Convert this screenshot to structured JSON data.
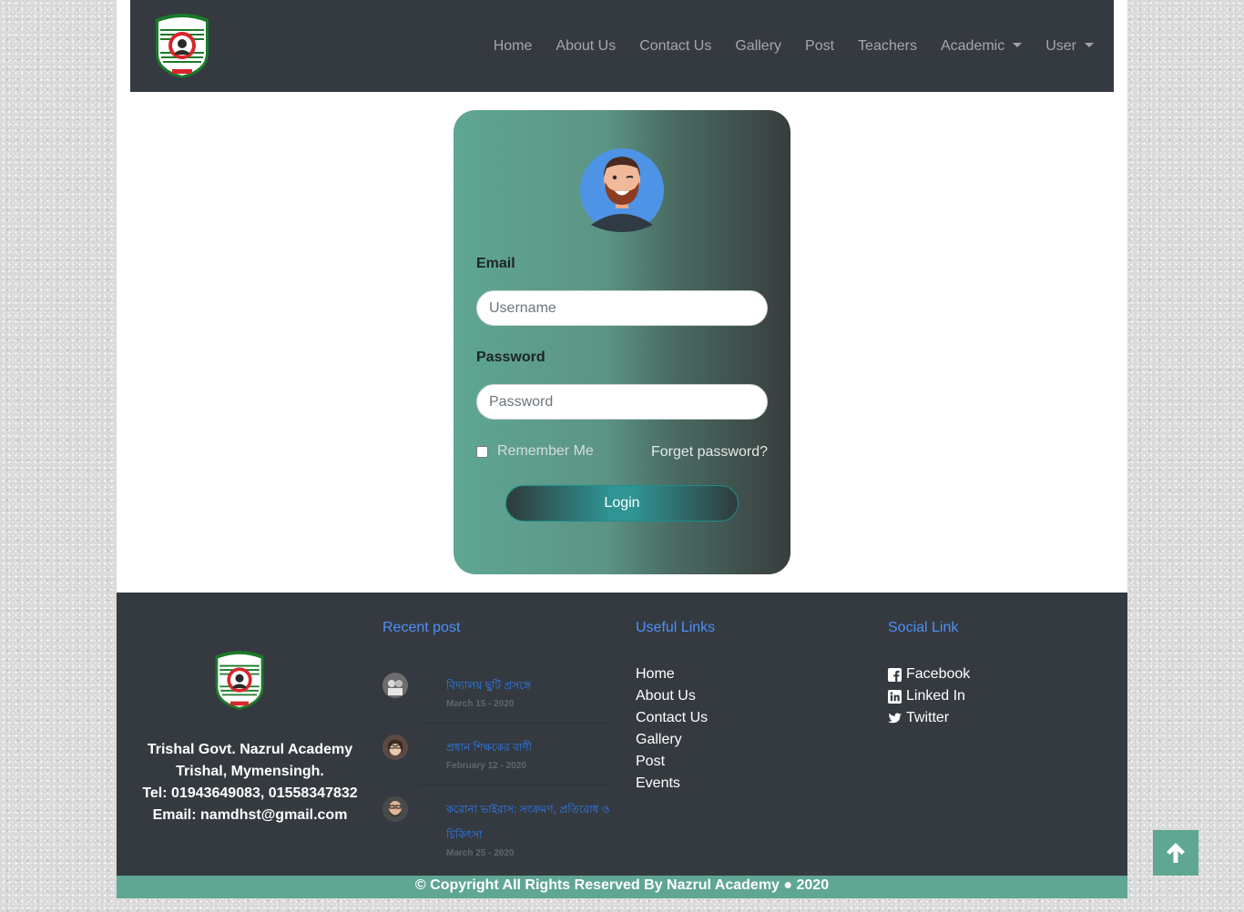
{
  "nav": {
    "logo_icon": "school-crest-logo",
    "items": [
      {
        "label": "Home"
      },
      {
        "label": "About Us"
      },
      {
        "label": "Contact Us"
      },
      {
        "label": "Gallery"
      },
      {
        "label": "Post"
      },
      {
        "label": "Teachers"
      },
      {
        "label": "Academic"
      },
      {
        "label": "User"
      }
    ]
  },
  "login": {
    "avatar_icon": "user-avatar-icon",
    "email_label": "Email",
    "email_placeholder": "Username",
    "email_value": "",
    "password_label": "Password",
    "password_placeholder": "Password",
    "password_value": "",
    "remember_label": "Remember Me",
    "remember_checked": false,
    "forget_label": "Forget password?",
    "login_button": "Login"
  },
  "footer": {
    "address_lines": [
      "Trishal Govt. Nazrul Academy",
      "Trishal, Mymensingh.",
      "Tel: 01943649083, 01558347832",
      "Email: namdhst@gmail.com"
    ],
    "recent_heading": "Recent post",
    "posts": [
      {
        "title": "বিদ্যালয় ছুটি প্রসঙ্গে",
        "date": "March 15 - 2020"
      },
      {
        "title": "প্রধান শিক্ষকের বাণী",
        "date": "February 12 - 2020"
      },
      {
        "title": "করোনা ভাইরাস: সংক্রমণ, প্রতিরোধ ও চিকিৎসা",
        "date": "March 25 - 2020"
      }
    ],
    "useful_heading": "Useful Links",
    "useful_links": [
      {
        "label": "Home"
      },
      {
        "label": "About Us"
      },
      {
        "label": "Contact Us"
      },
      {
        "label": "Gallery"
      },
      {
        "label": "Post"
      },
      {
        "label": "Events"
      }
    ],
    "social_heading": "Social Link",
    "social_links": [
      {
        "label": "Facebook",
        "icon": "facebook-icon"
      },
      {
        "label": "Linked In",
        "icon": "linkedin-icon"
      },
      {
        "label": "Twitter",
        "icon": "twitter-icon"
      }
    ],
    "copyright": "© Copyright All Rights Reserved By Nazrul Academy ● 2020"
  },
  "scroll_top_icon": "arrow-up-icon",
  "colors": {
    "navbar_bg": "#343a40",
    "accent_green": "#5fa693",
    "link_blue": "#4f8ff7"
  }
}
